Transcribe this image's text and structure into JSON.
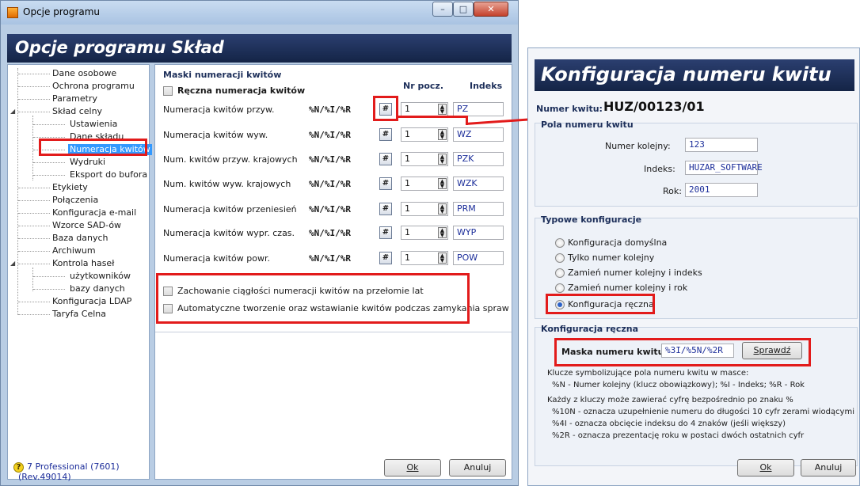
{
  "left_window": {
    "title": "Opcje programu",
    "banner": "Opcje programu Skład",
    "tree": [
      {
        "label": "Dane osobowe"
      },
      {
        "label": "Ochrona programu"
      },
      {
        "label": "Parametry"
      },
      {
        "label": "Skład celny"
      },
      {
        "label": "Ustawienia"
      },
      {
        "label": "Dane składu"
      },
      {
        "label": "Numeracja kwitów"
      },
      {
        "label": "Wydruki"
      },
      {
        "label": "Eksport do bufora"
      },
      {
        "label": "Etykiety"
      },
      {
        "label": "Połączenia"
      },
      {
        "label": "Konfiguracja e-mail"
      },
      {
        "label": "Wzorce SAD-ów"
      },
      {
        "label": "Baza danych"
      },
      {
        "label": "Archiwum"
      },
      {
        "label": "Kontrola haseł"
      },
      {
        "label": "użytkowników"
      },
      {
        "label": "bazy danych"
      },
      {
        "label": "Konfiguracja LDAP"
      },
      {
        "label": "Taryfa Celna"
      }
    ],
    "version_line1": "7 Professional (7601)",
    "version_line2": "(Rev.49014)",
    "panel": {
      "heading": "Maski numeracji kwitów",
      "manual_checkbox": "Ręczna numeracja kwitów",
      "col_nr": "Nr pocz.",
      "col_index": "Indeks",
      "rows": [
        {
          "label": "Numeracja kwitów przyw.",
          "mask": "%N/%I/%R",
          "nr": "1",
          "index": "PZ"
        },
        {
          "label": "Numeracja kwitów wyw.",
          "mask": "%N/%I/%R",
          "nr": "1",
          "index": "WZ"
        },
        {
          "label": "Num. kwitów przyw. krajowych",
          "mask": "%N/%I/%R",
          "nr": "1",
          "index": "PZK"
        },
        {
          "label": "Num. kwitów wyw. krajowych",
          "mask": "%N/%I/%R",
          "nr": "1",
          "index": "WZK"
        },
        {
          "label": "Numeracja kwitów przeniesień",
          "mask": "%N/%I/%R",
          "nr": "1",
          "index": "PRM"
        },
        {
          "label": "Numeracja kwitów wypr. czas.",
          "mask": "%N/%I/%R",
          "nr": "1",
          "index": "WYP"
        },
        {
          "label": "Numeracja kwitów powr.",
          "mask": "%N/%I/%R",
          "nr": "1",
          "index": "POW"
        }
      ],
      "check1": "Zachowanie ciągłości numeracji kwitów na przełomie lat",
      "check2": "Automatyczne tworzenie oraz wstawianie kwitów podczas zamykania spraw"
    },
    "ok": "Ok",
    "cancel": "Anuluj"
  },
  "right_window": {
    "banner": "Konfiguracja numeru kwitu",
    "number_label": "Numer kwitu:",
    "number_value": "HUZ/00123/01",
    "fields_title": "Pola numeru kwitu",
    "serial_label": "Numer kolejny:",
    "serial_value": "123",
    "index_label": "Indeks:",
    "index_value": "HUZAR_SOFTWARE",
    "year_label": "Rok:",
    "year_value": "2001",
    "typical_title": "Typowe konfiguracje",
    "radios": [
      {
        "label": "Konfiguracja domyślna",
        "selected": false
      },
      {
        "label": "Tylko numer kolejny",
        "selected": false
      },
      {
        "label": "Zamień numer kolejny i indeks",
        "selected": false
      },
      {
        "label": "Zamień numer kolejny i rok",
        "selected": false
      },
      {
        "label": "Konfiguracja ręczna",
        "selected": true
      }
    ],
    "manual_title": "Konfiguracja ręczna",
    "mask_label": "Maska numeru kwitu:",
    "mask_value": "%3I/%5N/%2R",
    "check_button": "Sprawdź",
    "hints": [
      "Klucze symbolizujące pola numeru kwitu w masce:",
      "%N - Numer kolejny (klucz obowiązkowy); %I - Indeks; %R - Rok",
      "Każdy z kluczy może zawierać cyfrę bezpośrednio po znaku %",
      "%10N - oznacza uzupełnienie numeru do długości 10 cyfr zerami wiodącymi",
      "%4I - oznacza obcięcie indeksu do 4 znaków (jeśli większy)",
      "%2R - oznacza prezentację roku w postaci dwóch ostatnich cyfr"
    ],
    "ok": "Ok",
    "cancel": "Anuluj"
  },
  "colors": {
    "banner_bg": "#1e2f5a",
    "highlight": "#e21b1b",
    "selection": "#3399ff",
    "window_frame": "#b9cde4"
  }
}
